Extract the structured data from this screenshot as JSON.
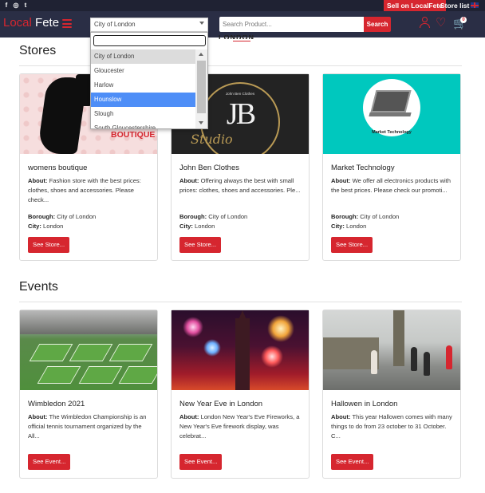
{
  "topbar": {
    "social_icons": [
      "facebook-icon",
      "instagram-icon",
      "twitter-icon"
    ],
    "social_glyphs": [
      "f",
      "◎",
      "t"
    ],
    "sell_link": "Sell on LocalFete",
    "store_list": "Store list"
  },
  "navbar": {
    "logo_part1": "Local",
    "logo_part2": "Fete",
    "city_select_value": "City of London",
    "search_placeholder": "Search Product...",
    "search_button": "Search",
    "cart_count": "0"
  },
  "page": {
    "city_heading": "LONDON"
  },
  "dropdown": {
    "search_value": "",
    "options": [
      "City of London",
      "Gloucester",
      "Harlow",
      "Hounslow",
      "Slough",
      "South Gloucestershire"
    ],
    "selected": "City of London",
    "highlighted": "Hounslow"
  },
  "stores": {
    "title": "Stores",
    "about_label": "About:",
    "borough_label": "Borough:",
    "city_label": "City:",
    "button_label": "See Store...",
    "items": [
      {
        "name": "womens boutique",
        "about": "Fashion store with the best prices: clothes, shoes and accessories. Please check...",
        "borough": "City of London",
        "city": "London",
        "image_text": "BOUTIQUE"
      },
      {
        "name": "John Ben Clothes",
        "about": "Offering always the best with small prices: clothes, shoes and accessories. Ple...",
        "borough": "City of London",
        "city": "London",
        "image_small": "John Ben Clothes",
        "image_mono": "JB",
        "image_script": "Studio"
      },
      {
        "name": "Market Technology",
        "about": "We offer all electronics products with the best prices. Please check our promoti...",
        "borough": "City of London",
        "city": "London",
        "image_text": "Market Technology"
      }
    ]
  },
  "events": {
    "title": "Events",
    "about_label": "About:",
    "button_label": "See Event...",
    "items": [
      {
        "name": "Wimbledon 2021",
        "about": "The Wimbledon Championship is an official tennis tournament organized by the All..."
      },
      {
        "name": "New Year Eve in London",
        "about": "London New Year's Eve Fireworks, a New Year's Eve firework display, was celebrat..."
      },
      {
        "name": "Hallowen in London",
        "about": "This year Hallowen comes with many things to do from 23 october to 31 October. C..."
      }
    ]
  },
  "colors": {
    "brand_red": "#d6262f",
    "nav_bg": "#2a2e45",
    "topbar_bg": "#1f2233",
    "dropdown_highlight": "#4e8ef7"
  }
}
